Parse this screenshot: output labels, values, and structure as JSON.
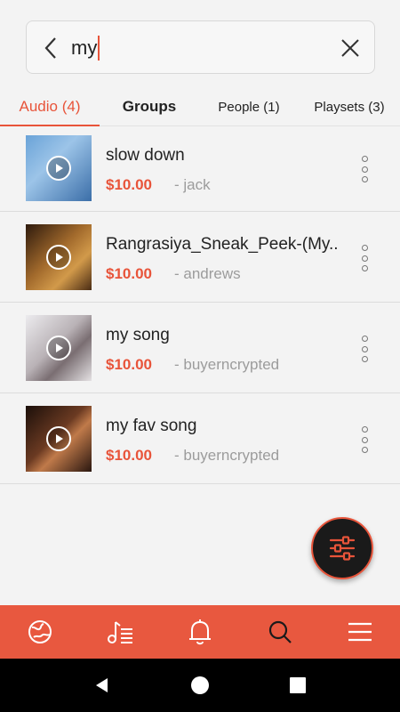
{
  "search": {
    "query": "my",
    "back_icon": "chevron-left-icon",
    "clear_icon": "close-icon"
  },
  "tabs": [
    {
      "label": "Audio (4)",
      "active": true
    },
    {
      "label": "Groups",
      "active": false
    },
    {
      "label": "People (1)",
      "active": false
    },
    {
      "label": "Playsets (3)",
      "active": false
    }
  ],
  "results": [
    {
      "title": "slow down",
      "price": "$10.00",
      "seller": "- jack",
      "thumb_color": "#4f87c4"
    },
    {
      "title": "Rangrasiya_Sneak_Peek-(My..",
      "price": "$10.00",
      "seller": "- andrews",
      "thumb_color": "#8a5a2a"
    },
    {
      "title": "my song",
      "price": "$10.00",
      "seller": "- buyerncrypted",
      "thumb_color": "#c9c4c6"
    },
    {
      "title": "my fav song",
      "price": "$10.00",
      "seller": "- buyerncrypted",
      "thumb_color": "#3a2218"
    }
  ],
  "fab": {
    "icon": "filter-sliders-icon"
  },
  "bottom_nav": [
    {
      "icon": "globe-icon"
    },
    {
      "icon": "music-playlist-icon"
    },
    {
      "icon": "bell-icon"
    },
    {
      "icon": "search-icon"
    },
    {
      "icon": "menu-icon"
    }
  ],
  "colors": {
    "accent": "#e8543a",
    "nav_bg": "#e8583f",
    "text": "#222222",
    "muted": "#9c9c9c"
  }
}
